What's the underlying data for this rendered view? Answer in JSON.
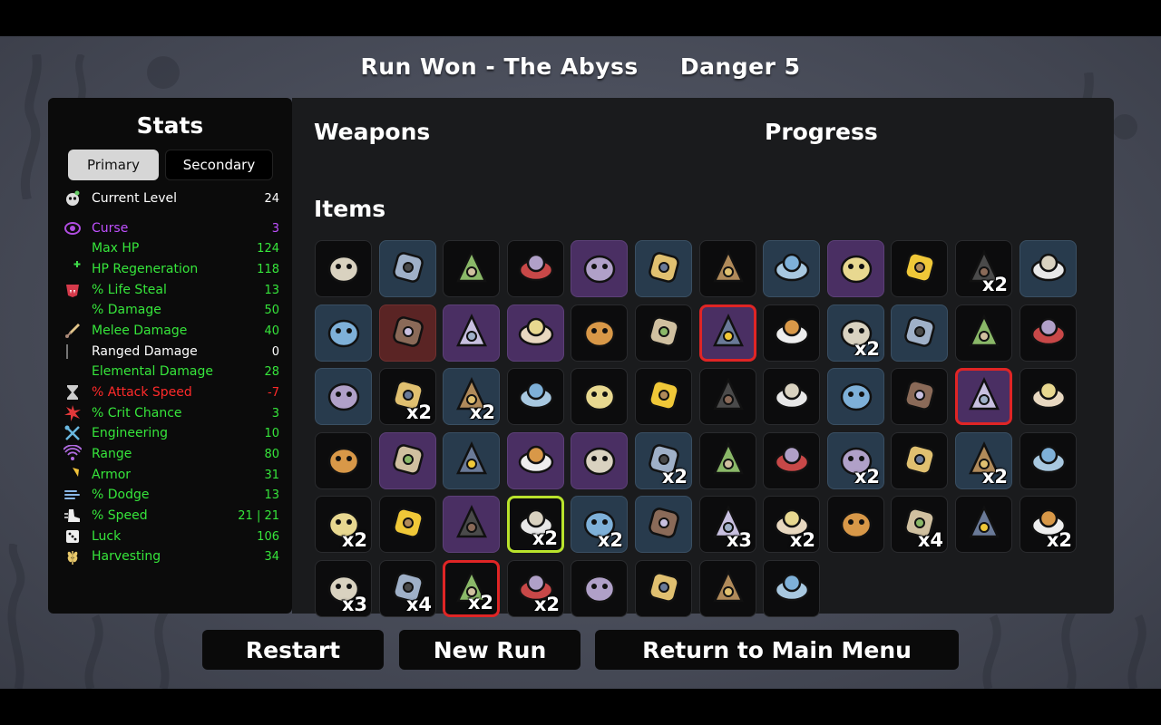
{
  "header": {
    "run_result": "Run Won - The Abyss",
    "danger": "Danger 5"
  },
  "stats": {
    "title": "Stats",
    "tabs": {
      "primary": "Primary",
      "secondary": "Secondary",
      "active": "Primary"
    },
    "rows": [
      {
        "label": "Current Level",
        "value": "24",
        "color": "#ffffff",
        "value_color": "#ffffff",
        "icon": "skull-level-icon",
        "icon_color": "#dddddd"
      },
      {
        "label": "Curse",
        "value": "3",
        "color": "#c050ff",
        "value_color": "#c050ff",
        "icon": "curse-eye-icon",
        "icon_color": "#b04de0"
      },
      {
        "label": "Max HP",
        "value": "124",
        "color": "#36e53b",
        "value_color": "#36e53b",
        "icon": "heart-icon",
        "icon_color": "#3fdc4a"
      },
      {
        "label": "HP Regeneration",
        "value": "118",
        "color": "#36e53b",
        "value_color": "#36e53b",
        "icon": "heart-plus-icon",
        "icon_color": "#3fdc4a"
      },
      {
        "label": "% Life Steal",
        "value": "13",
        "color": "#36e53b",
        "value_color": "#36e53b",
        "icon": "vampire-icon",
        "icon_color": "#d63a4b"
      },
      {
        "label": "% Damage",
        "value": "50",
        "color": "#36e53b",
        "value_color": "#36e53b",
        "icon": "muscle-icon",
        "icon_color": "#e0564b"
      },
      {
        "label": "Melee Damage",
        "value": "40",
        "color": "#36e53b",
        "value_color": "#36e53b",
        "icon": "sword-icon",
        "icon_color": "#e2c58a"
      },
      {
        "label": "Ranged Damage",
        "value": "0",
        "color": "#ffffff",
        "value_color": "#ffffff",
        "icon": "bow-icon",
        "icon_color": "#e06bd0"
      },
      {
        "label": "Elemental Damage",
        "value": "28",
        "color": "#36e53b",
        "value_color": "#36e53b",
        "icon": "flame-icon",
        "icon_color": "#f08a3a"
      },
      {
        "label": "% Attack Speed",
        "value": "-7",
        "color": "#ff2a2a",
        "value_color": "#ff2a2a",
        "icon": "hourglass-icon",
        "icon_color": "#cccccc"
      },
      {
        "label": "% Crit Chance",
        "value": "3",
        "color": "#36e53b",
        "value_color": "#36e53b",
        "icon": "crit-burst-icon",
        "icon_color": "#e2383a"
      },
      {
        "label": "Engineering",
        "value": "10",
        "color": "#36e53b",
        "value_color": "#36e53b",
        "icon": "wrench-icon",
        "icon_color": "#6ab8e0"
      },
      {
        "label": "Range",
        "value": "80",
        "color": "#36e53b",
        "value_color": "#36e53b",
        "icon": "range-waves-icon",
        "icon_color": "#b06be0"
      },
      {
        "label": "Armor",
        "value": "31",
        "color": "#36e53b",
        "value_color": "#36e53b",
        "icon": "shield-icon",
        "icon_color": "#f0c23a"
      },
      {
        "label": "% Dodge",
        "value": "13",
        "color": "#36e53b",
        "value_color": "#36e53b",
        "icon": "dodge-wind-icon",
        "icon_color": "#8ab8e8"
      },
      {
        "label": "% Speed",
        "value": "21 | 21",
        "color": "#36e53b",
        "value_color": "#36e53b",
        "icon": "speed-boot-icon",
        "icon_color": "#eeeeee"
      },
      {
        "label": "Luck",
        "value": "106",
        "color": "#36e53b",
        "value_color": "#36e53b",
        "icon": "dice-icon",
        "icon_color": "#eeeeee"
      },
      {
        "label": "Harvesting",
        "value": "34",
        "color": "#36e53b",
        "value_color": "#36e53b",
        "icon": "wheat-icon",
        "icon_color": "#e8c86a"
      }
    ]
  },
  "main": {
    "weapons_title": "Weapons",
    "progress_title": "Progress",
    "items_title": "Items",
    "items": [
      {
        "icon": "spiked-helmet-icon",
        "tint": "dark",
        "count": ""
      },
      {
        "icon": "gadget-arm-icon",
        "tint": "blue",
        "count": ""
      },
      {
        "icon": "sprout-icon",
        "tint": "dark",
        "count": ""
      },
      {
        "icon": "syringe-icon",
        "tint": "dark",
        "count": ""
      },
      {
        "icon": "handcuffs-icon",
        "tint": "purple",
        "count": ""
      },
      {
        "icon": "scarf-icon",
        "tint": "blue",
        "count": ""
      },
      {
        "icon": "sack-icon",
        "tint": "dark",
        "count": ""
      },
      {
        "icon": "potion-flask-icon",
        "tint": "blue",
        "count": ""
      },
      {
        "icon": "broken-lamp-icon",
        "tint": "purple",
        "count": ""
      },
      {
        "icon": "bee-icon",
        "tint": "dark",
        "count": ""
      },
      {
        "icon": "coal-rock-icon",
        "tint": "dark",
        "count": "x2"
      },
      {
        "icon": "ninja-pickaxe-icon",
        "tint": "blue",
        "count": ""
      },
      {
        "icon": "jar-icon",
        "tint": "blue",
        "count": ""
      },
      {
        "icon": "werewolf-icon",
        "tint": "red",
        "count": ""
      },
      {
        "icon": "broken-mirror-icon",
        "tint": "purple",
        "count": ""
      },
      {
        "icon": "torn-cloth-icon",
        "tint": "purple",
        "count": ""
      },
      {
        "icon": "hamster-icon",
        "tint": "dark",
        "count": ""
      },
      {
        "icon": "slug-icon",
        "tint": "dark",
        "count": ""
      },
      {
        "icon": "ball-and-chain-icon",
        "tint": "purple",
        "count": "",
        "highlight": "red"
      },
      {
        "icon": "tooth-icon",
        "tint": "dark",
        "count": ""
      },
      {
        "icon": "alarm-creature-icon",
        "tint": "blue",
        "count": "x2"
      },
      {
        "icon": "snail-icon",
        "tint": "blue",
        "count": ""
      },
      {
        "icon": "white-mask-icon",
        "tint": "dark",
        "count": ""
      },
      {
        "icon": "lizard-icon",
        "tint": "dark",
        "count": ""
      },
      {
        "icon": "vest-icon",
        "tint": "blue",
        "count": ""
      },
      {
        "icon": "rubber-duck-icon",
        "tint": "dark",
        "count": "x2"
      },
      {
        "icon": "magnifier-icon",
        "tint": "blue",
        "count": "x2"
      },
      {
        "icon": "bandaged-head-icon",
        "tint": "dark",
        "count": ""
      },
      {
        "icon": "beanie-icon",
        "tint": "dark",
        "count": ""
      },
      {
        "icon": "palm-tree-icon",
        "tint": "dark",
        "count": ""
      },
      {
        "icon": "snowball-icon",
        "tint": "dark",
        "count": ""
      },
      {
        "icon": "penguin-icon",
        "tint": "dark",
        "count": ""
      },
      {
        "icon": "coffee-machine-icon",
        "tint": "blue",
        "count": ""
      },
      {
        "icon": "turret-icon",
        "tint": "dark",
        "count": ""
      },
      {
        "icon": "noose-rope-icon",
        "tint": "purple",
        "count": "",
        "highlight": "red"
      },
      {
        "icon": "meat-chunk-icon",
        "tint": "dark",
        "count": ""
      },
      {
        "icon": "feather-icon",
        "tint": "dark",
        "count": ""
      },
      {
        "icon": "claw-marks-icon",
        "tint": "purple",
        "count": ""
      },
      {
        "icon": "butterfly-icon",
        "tint": "blue",
        "count": ""
      },
      {
        "icon": "frozen-heart-icon",
        "tint": "purple",
        "count": ""
      },
      {
        "icon": "goldfish-icon",
        "tint": "purple",
        "count": ""
      },
      {
        "icon": "cornucopia-icon",
        "tint": "blue",
        "count": "x2"
      },
      {
        "icon": "medic-backpack-icon",
        "tint": "dark",
        "count": ""
      },
      {
        "icon": "crescent-moon-icon",
        "tint": "dark",
        "count": ""
      },
      {
        "icon": "piranha-icon",
        "tint": "blue",
        "count": "x2"
      },
      {
        "icon": "lemonade-cup-icon",
        "tint": "dark",
        "count": ""
      },
      {
        "icon": "stone-slab-icon",
        "tint": "blue",
        "count": "x2"
      },
      {
        "icon": "cracked-face-icon",
        "tint": "dark",
        "count": ""
      },
      {
        "icon": "tentacle-horn-icon",
        "tint": "dark",
        "count": "x2"
      },
      {
        "icon": "poison-syringe-icon",
        "tint": "dark",
        "count": ""
      },
      {
        "icon": "green-alien-icon",
        "tint": "purple",
        "count": ""
      },
      {
        "icon": "dynamite-icon",
        "tint": "dark",
        "count": "x2",
        "highlight": "yellow"
      },
      {
        "icon": "garden-icon",
        "tint": "blue",
        "count": "x2"
      },
      {
        "icon": "campfire-icon",
        "tint": "blue",
        "count": ""
      },
      {
        "icon": "ghost-icon",
        "tint": "dark",
        "count": "x3"
      },
      {
        "icon": "propeller-hat-icon",
        "tint": "dark",
        "count": "x2"
      },
      {
        "icon": "tree-icon",
        "tint": "dark",
        "count": ""
      },
      {
        "icon": "bubbling-pot-icon",
        "tint": "dark",
        "count": "x4"
      },
      {
        "icon": "cake-slice-icon",
        "tint": "dark",
        "count": ""
      },
      {
        "icon": "red-cube-creature-icon",
        "tint": "dark",
        "count": "x2"
      },
      {
        "icon": "scythe-worm-icon",
        "tint": "dark",
        "count": "x3"
      },
      {
        "icon": "treasure-map-icon",
        "tint": "dark",
        "count": "x4"
      },
      {
        "icon": "monkey-icon",
        "tint": "dark",
        "count": "x2",
        "highlight": "red"
      },
      {
        "icon": "red-spear-icon",
        "tint": "dark",
        "count": "x2"
      },
      {
        "icon": "landmine-icon",
        "tint": "dark",
        "count": ""
      },
      {
        "icon": "whistle-icon",
        "tint": "dark",
        "count": ""
      },
      {
        "icon": "flannel-shirt-icon",
        "tint": "dark",
        "count": ""
      },
      {
        "icon": "green-slime-icon",
        "tint": "dark",
        "count": ""
      }
    ]
  },
  "buttons": {
    "restart": "Restart",
    "new_run": "New Run",
    "main_menu": "Return to Main Menu"
  }
}
